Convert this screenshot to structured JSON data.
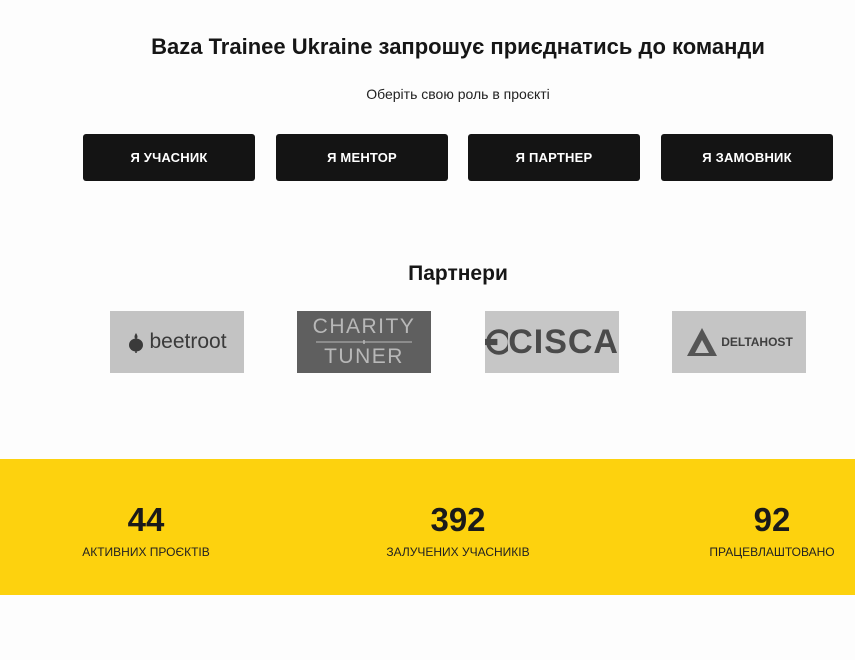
{
  "hero": {
    "title": "Baza Trainee Ukraine запрошує приєднатись до команди",
    "subtitle": "Оберіть свою роль в проєкті"
  },
  "roles": [
    {
      "label": "Я УЧАСНИК"
    },
    {
      "label": "Я МЕНТОР"
    },
    {
      "label": "Я ПАРТНЕР"
    },
    {
      "label": "Я ЗАМОВНИК"
    }
  ],
  "partners": {
    "title": "Партнери",
    "logos": [
      {
        "name": "beetroot",
        "text": "beetroot"
      },
      {
        "name": "charity-tuner",
        "line1": "CHARITY",
        "line2": "TUNER"
      },
      {
        "name": "cisca",
        "text": "CISCA"
      },
      {
        "name": "deltahost",
        "text": "DELTAHOST"
      }
    ]
  },
  "stats": [
    {
      "value": "44",
      "label": "АКТИВНИХ ПРОЄКТІВ"
    },
    {
      "value": "392",
      "label": "ЗАЛУЧЕНИХ УЧАСНИКІВ"
    },
    {
      "value": "92",
      "label": "ПРАЦЕВЛАШТОВАНО"
    }
  ],
  "colors": {
    "stats_background": "#fdd20e",
    "button_background": "#141414"
  }
}
